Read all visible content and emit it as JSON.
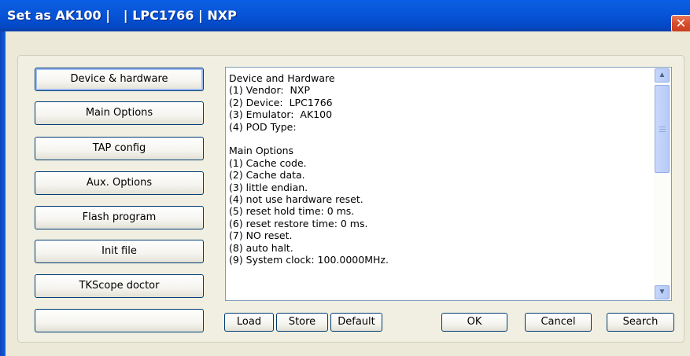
{
  "window": {
    "title": "Set as AK100 |   | LPC1766 | NXP",
    "close_glyph": "✕"
  },
  "side_buttons": [
    "Device & hardware",
    "Main Options",
    "TAP config",
    "Aux. Options",
    "Flash program",
    "Init file",
    "TKScope doctor",
    ""
  ],
  "info_lines": [
    "Device and Hardware",
    "(1) Vendor:  NXP",
    "(2) Device:  LPC1766",
    "(3) Emulator:  AK100",
    "(4) POD Type:",
    "",
    "Main Options",
    "(1) Cache code.",
    "(2) Cache data.",
    "(3) little endian.",
    "(4) not use hardware reset.",
    "(5) reset hold time: 0 ms.",
    "(6) reset restore time: 0 ms.",
    "(7) NO reset.",
    "(8) auto halt.",
    "(9) System clock: 100.0000MHz."
  ],
  "bottom_buttons": {
    "load": "Load",
    "store": "Store",
    "default": "Default",
    "ok": "OK",
    "cancel": "Cancel",
    "search": "Search"
  },
  "scrollbar": {
    "up_icon": "chevron-up-icon",
    "down_icon": "chevron-down-icon"
  },
  "colors": {
    "title_bar": "#0653d6",
    "dialog_bg": "#ece9d8",
    "button_border": "#003c74",
    "close_button": "#d9502f"
  }
}
